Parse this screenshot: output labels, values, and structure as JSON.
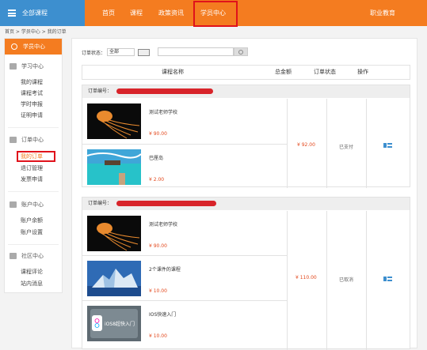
{
  "header": {
    "all_courses": "全部课程",
    "nav": [
      "首页",
      "课程",
      "政策资讯",
      "学员中心"
    ],
    "active_nav": "学员中心",
    "career": "职业教育"
  },
  "breadcrumb": "首页 > 学员中心 > 我的订单",
  "sidebar": {
    "head": "学员中心",
    "sections": [
      {
        "title": "学习中心",
        "icon": "book-icon",
        "items": [
          "我的课程",
          "课程考试",
          "学时申报",
          "证明申请"
        ]
      },
      {
        "title": "订单中心",
        "icon": "edit-icon",
        "items": [
          "我的订单",
          "退订管理",
          "发票申请"
        ]
      },
      {
        "title": "账户中心",
        "icon": "wallet-icon",
        "items": [
          "账户余额",
          "账户设置"
        ]
      },
      {
        "title": "社区中心",
        "icon": "people-icon",
        "items": [
          "课程评论",
          "站内消息"
        ]
      }
    ],
    "active_item": "我的订单"
  },
  "filter": {
    "label": "订单状态：",
    "select_value": "全部",
    "button": "查询",
    "search_value": ""
  },
  "table": {
    "headers": [
      "课程名称",
      "总金额",
      "订单状态",
      "操作"
    ]
  },
  "orders": [
    {
      "label": "订单编号：",
      "items": [
        {
          "title": "测试老师学校",
          "price": "¥ 90.00",
          "thumb": "jellyfish"
        },
        {
          "title": "巴厘岛",
          "price": "¥ 2.00",
          "thumb": "beach"
        }
      ],
      "total": "¥ 92.00",
      "status": "已支付"
    },
    {
      "label": "订单编号：",
      "items": [
        {
          "title": "测试老师学校",
          "price": "¥ 90.00",
          "thumb": "jellyfish"
        },
        {
          "title": "2个课件的课程",
          "price": "¥ 10.00",
          "thumb": "iceberg"
        },
        {
          "title": "IOS快速入门",
          "price": "¥ 10.00",
          "thumb": "ios",
          "thumb_text": "iOS8超快入门"
        }
      ],
      "total": "¥ 110.00",
      "status": "已取消"
    }
  ],
  "colors": {
    "brand_orange": "#f47c20",
    "brand_blue": "#3d8fcf",
    "highlight_red": "#e0121b",
    "price_red": "#e3471b"
  }
}
